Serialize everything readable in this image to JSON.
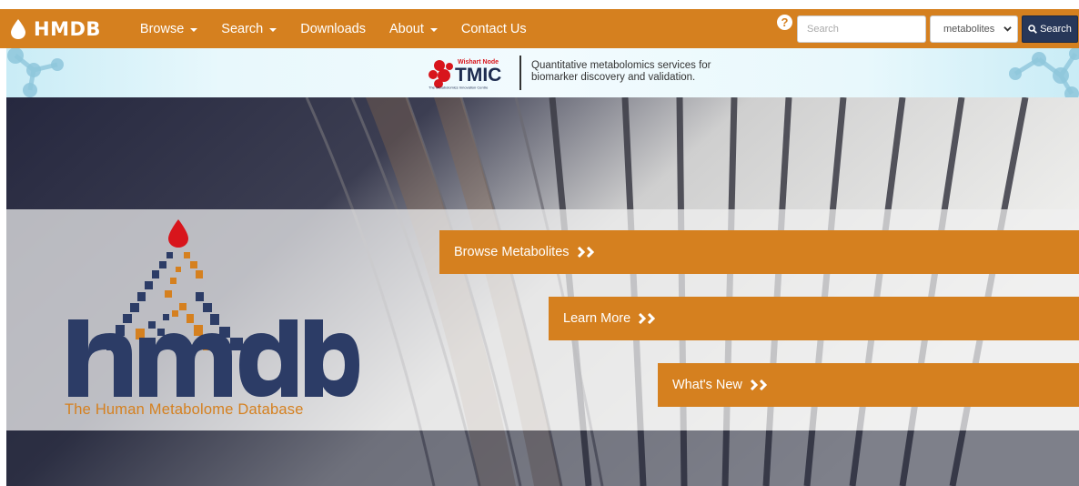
{
  "navbar": {
    "brand": "HMDB",
    "items": [
      {
        "label": "Browse",
        "dropdown": true
      },
      {
        "label": "Search",
        "dropdown": true
      },
      {
        "label": "Downloads",
        "dropdown": false
      },
      {
        "label": "About",
        "dropdown": true
      },
      {
        "label": "Contact Us",
        "dropdown": false
      }
    ],
    "help_icon": "question-circle-icon",
    "search_placeholder": "Search",
    "search_type": "metabolites",
    "search_button": "Search",
    "color": "#d5801f"
  },
  "banner": {
    "tmic_node": "Wishart Node",
    "tmic_name": "TMIC",
    "tmic_sub": "The Metabolomics Innovation Centre",
    "tagline_line1": "Quantitative metabolomics services for",
    "tagline_line2": "biomarker discovery and validation."
  },
  "hero": {
    "logo_word": "hmdb",
    "logo_tagline": "The Human Metabolome Database",
    "buttons": [
      {
        "label": "Browse Metabolites"
      },
      {
        "label": "Learn More"
      },
      {
        "label": "What's New"
      }
    ]
  },
  "colors": {
    "accent": "#d5801f",
    "navy": "#273759",
    "logo_dark": "#2c3c66",
    "drop_red": "#d8151c"
  }
}
